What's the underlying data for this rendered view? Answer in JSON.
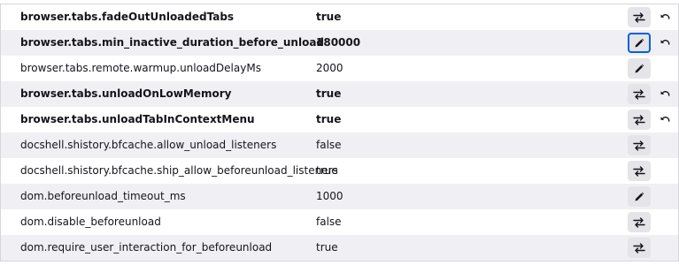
{
  "prefs": [
    {
      "name": "browser.tabs.fadeOutUnloadedTabs",
      "value": "true",
      "modified": true,
      "action": "toggle",
      "reset": true,
      "alt": false,
      "focused": false
    },
    {
      "name": "browser.tabs.min_inactive_duration_before_unload",
      "value": "180000",
      "modified": true,
      "action": "edit",
      "reset": true,
      "alt": true,
      "focused": true
    },
    {
      "name": "browser.tabs.remote.warmup.unloadDelayMs",
      "value": "2000",
      "modified": false,
      "action": "edit",
      "reset": false,
      "alt": false,
      "focused": false
    },
    {
      "name": "browser.tabs.unloadOnLowMemory",
      "value": "true",
      "modified": true,
      "action": "toggle",
      "reset": true,
      "alt": true,
      "focused": false
    },
    {
      "name": "browser.tabs.unloadTabInContextMenu",
      "value": "true",
      "modified": true,
      "action": "toggle",
      "reset": true,
      "alt": false,
      "focused": false
    },
    {
      "name": "docshell.shistory.bfcache.allow_unload_listeners",
      "value": "false",
      "modified": false,
      "action": "toggle",
      "reset": false,
      "alt": true,
      "focused": false
    },
    {
      "name": "docshell.shistory.bfcache.ship_allow_beforeunload_listeners",
      "value": "true",
      "modified": false,
      "action": "toggle",
      "reset": false,
      "alt": false,
      "focused": false
    },
    {
      "name": "dom.beforeunload_timeout_ms",
      "value": "1000",
      "modified": false,
      "action": "edit",
      "reset": false,
      "alt": true,
      "focused": false
    },
    {
      "name": "dom.disable_beforeunload",
      "value": "false",
      "modified": false,
      "action": "toggle",
      "reset": false,
      "alt": false,
      "focused": false
    },
    {
      "name": "dom.require_user_interaction_for_beforeunload",
      "value": "true",
      "modified": false,
      "action": "toggle",
      "reset": false,
      "alt": true,
      "focused": false
    }
  ],
  "icons": {
    "toggle": "toggle-arrows-icon",
    "edit": "pencil-icon",
    "reset": "undo-icon"
  }
}
